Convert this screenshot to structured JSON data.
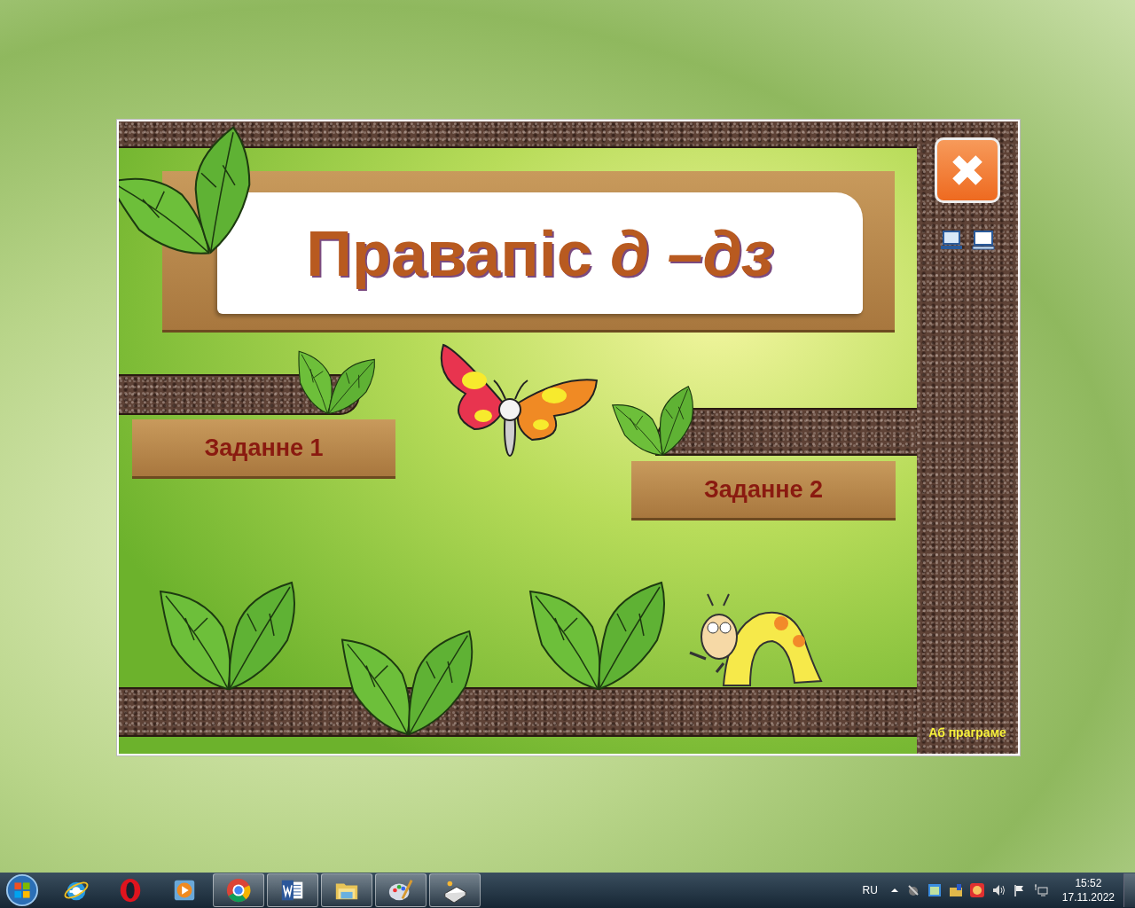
{
  "app": {
    "title": "Правапіс *д –дз*",
    "tasks": [
      {
        "label": "Заданне 1"
      },
      {
        "label": "Заданне 2"
      }
    ],
    "about_link": "Аб праграме"
  },
  "taskbar": {
    "apps": [
      {
        "kind": "ie",
        "running": false
      },
      {
        "kind": "opera",
        "running": false
      },
      {
        "kind": "media",
        "running": false
      },
      {
        "kind": "chrome",
        "running": true
      },
      {
        "kind": "word",
        "running": true
      },
      {
        "kind": "folder",
        "running": true
      },
      {
        "kind": "paint",
        "running": true
      },
      {
        "kind": "book",
        "running": true
      }
    ],
    "language": "RU",
    "time": "15:52",
    "date": "17.11.2022"
  }
}
